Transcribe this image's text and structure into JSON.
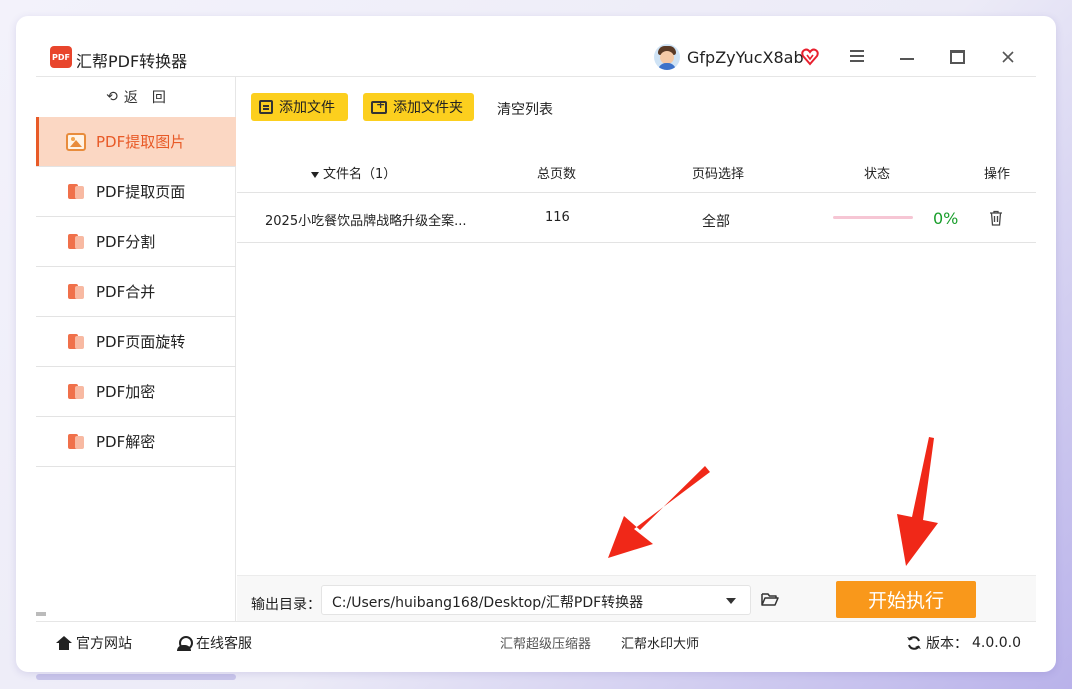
{
  "app": {
    "title": "汇帮PDF转换器",
    "logo_text": "PDF",
    "username": "GfpZyYucX8ab"
  },
  "sidebar": {
    "back_label": "返　回",
    "items": [
      {
        "label": "PDF提取图片",
        "active": true,
        "icon": "image-icon"
      },
      {
        "label": "PDF提取页面",
        "active": false,
        "icon": "pdf-doc-icon"
      },
      {
        "label": "PDF分割",
        "active": false,
        "icon": "pdf-doc-icon"
      },
      {
        "label": "PDF合并",
        "active": false,
        "icon": "pdf-doc-icon"
      },
      {
        "label": "PDF页面旋转",
        "active": false,
        "icon": "pdf-doc-icon"
      },
      {
        "label": "PDF加密",
        "active": false,
        "icon": "pdf-doc-icon"
      },
      {
        "label": "PDF解密",
        "active": false,
        "icon": "pdf-doc-icon"
      }
    ]
  },
  "toolbar": {
    "add_file": "添加文件",
    "add_folder": "添加文件夹",
    "clear_list": "清空列表"
  },
  "table": {
    "headers": {
      "name": "文件名（1）",
      "pages": "总页数",
      "range": "页码选择",
      "status": "状态",
      "op": "操作"
    },
    "rows": [
      {
        "name": "2025小吃餐饮品牌战略升级全案...",
        "pages": "116",
        "range": "全部",
        "progress": 0,
        "percent": "0%"
      }
    ]
  },
  "output": {
    "label": "输出目录：",
    "path": "C:/Users/huibang168/Desktop/汇帮PDF转换器",
    "start_button": "开始执行"
  },
  "footer": {
    "website": "官方网站",
    "service": "在线客服",
    "compressor": "汇帮超级压缩器",
    "watermark": "汇帮水印大师",
    "version_label": "版本：",
    "version": "4.0.0.0"
  },
  "colors": {
    "accent": "#e85a27",
    "active_bg": "#fbd7c3",
    "toolbar_button": "#fccf1e",
    "start_button": "#f9981b",
    "progress_ok": "#1a9e2c",
    "annotation_arrow": "#f02818"
  }
}
